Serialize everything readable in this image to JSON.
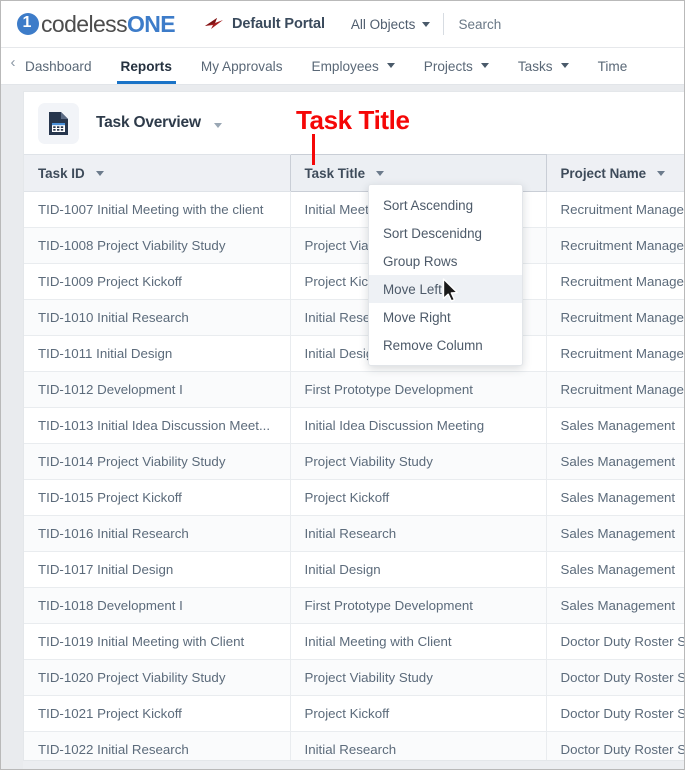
{
  "topbar": {
    "logo_mark": "1",
    "logo_text_a": "codeless",
    "logo_text_b": "ONE",
    "logo_icon": "codeless-one-logo",
    "portal_icon": "portal-arrow-icon",
    "portal_label": "Default Portal",
    "objects_filter": "All Objects",
    "objects_caret_icon": "chevron-down-icon",
    "search_placeholder": "Search",
    "search_value": ""
  },
  "nav": {
    "back_icon": "chevron-left-icon",
    "items": [
      {
        "label": "Dashboard",
        "active": false,
        "caret": false
      },
      {
        "label": "Reports",
        "active": true,
        "caret": false
      },
      {
        "label": "My Approvals",
        "active": false,
        "caret": false
      },
      {
        "label": "Employees",
        "active": false,
        "caret": true
      },
      {
        "label": "Projects",
        "active": false,
        "caret": true
      },
      {
        "label": "Tasks",
        "active": false,
        "caret": true
      },
      {
        "label": "Time",
        "active": false,
        "caret": false
      }
    ]
  },
  "card": {
    "report_icon": "report-document-icon",
    "title": "Task Overview",
    "title_caret_icon": "chevron-down-icon"
  },
  "annotation": {
    "text": "Task Title",
    "color": "#f50707",
    "pointer": "vertical-line"
  },
  "table": {
    "columns": [
      {
        "label": "Task ID",
        "selected": false,
        "caret_icon": "chevron-down-icon"
      },
      {
        "label": "Task Title",
        "selected": true,
        "caret_icon": "chevron-down-icon"
      },
      {
        "label": "Project Name",
        "selected": false,
        "caret_icon": "chevron-down-icon"
      }
    ],
    "rows": [
      {
        "task_id": "TID-1007 Initial Meeting with the client",
        "task_title": "Initial Meeting with the client",
        "project_name": "Recruitment Management"
      },
      {
        "task_id": "TID-1008 Project Viability Study",
        "task_title": "Project Viability Study",
        "project_name": "Recruitment Management"
      },
      {
        "task_id": "TID-1009 Project Kickoff",
        "task_title": "Project Kickoff",
        "project_name": "Recruitment Management"
      },
      {
        "task_id": "TID-1010 Initial Research",
        "task_title": "Initial Research",
        "project_name": "Recruitment Management"
      },
      {
        "task_id": "TID-1011 Initial Design",
        "task_title": "Initial Design",
        "project_name": "Recruitment Management"
      },
      {
        "task_id": "TID-1012 Development I",
        "task_title": "First Prototype Development",
        "project_name": "Recruitment Management"
      },
      {
        "task_id": "TID-1013 Initial Idea Discussion Meet...",
        "task_title": "Initial Idea Discussion Meeting",
        "project_name": "Sales Management"
      },
      {
        "task_id": "TID-1014 Project Viability Study",
        "task_title": "Project Viability Study",
        "project_name": "Sales Management"
      },
      {
        "task_id": "TID-1015 Project Kickoff",
        "task_title": "Project Kickoff",
        "project_name": "Sales Management"
      },
      {
        "task_id": "TID-1016 Initial Research",
        "task_title": "Initial Research",
        "project_name": "Sales Management"
      },
      {
        "task_id": "TID-1017 Initial Design",
        "task_title": "Initial Design",
        "project_name": "Sales Management"
      },
      {
        "task_id": "TID-1018 Development I",
        "task_title": "First Prototype Development",
        "project_name": "Sales Management"
      },
      {
        "task_id": "TID-1019 Initial Meeting with Client",
        "task_title": "Initial Meeting with Client",
        "project_name": "Doctor Duty Roster S"
      },
      {
        "task_id": "TID-1020 Project Viability Study",
        "task_title": "Project Viability Study",
        "project_name": "Doctor Duty Roster S"
      },
      {
        "task_id": "TID-1021 Project Kickoff",
        "task_title": "Project Kickoff",
        "project_name": "Doctor Duty Roster S"
      },
      {
        "task_id": "TID-1022 Initial Research",
        "task_title": "Initial Research",
        "project_name": "Doctor Duty Roster S"
      }
    ]
  },
  "column_menu": {
    "items": [
      {
        "label": "Sort Ascending",
        "highlighted": false
      },
      {
        "label": "Sort Descenidng",
        "highlighted": false
      },
      {
        "label": "Group Rows",
        "highlighted": false
      },
      {
        "label": "Move Left",
        "highlighted": true
      },
      {
        "label": "Move Right",
        "highlighted": false
      },
      {
        "label": "Remove Column",
        "highlighted": false
      }
    ]
  },
  "cursor": {
    "icon": "mouse-pointer-icon"
  }
}
